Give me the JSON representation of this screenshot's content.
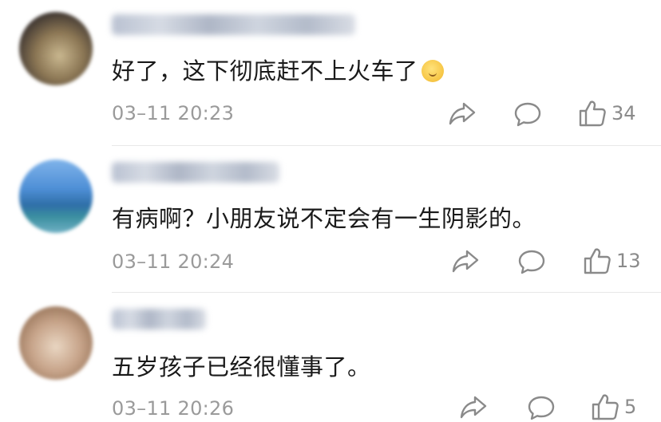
{
  "comments": [
    {
      "text": "好了，这下彻底赶不上火车了",
      "emoji_icon": "shushing-face-icon",
      "timestamp": "03–11 20:23",
      "likes": "34"
    },
    {
      "text": "有病啊？小朋友说不定会有一生阴影的。",
      "timestamp": "03–11 20:24",
      "likes": "13"
    },
    {
      "text": "五岁孩子已经很懂事了。",
      "timestamp": "03–11 20:26",
      "likes": "5"
    }
  ],
  "icons": {
    "share": "share-icon",
    "comment": "comment-icon",
    "like": "thumbs-up-icon"
  },
  "colors": {
    "text": "#1a1a1a",
    "meta": "#9a9a9a",
    "icon": "#8a8a8a",
    "divider": "#e8e8e8"
  }
}
